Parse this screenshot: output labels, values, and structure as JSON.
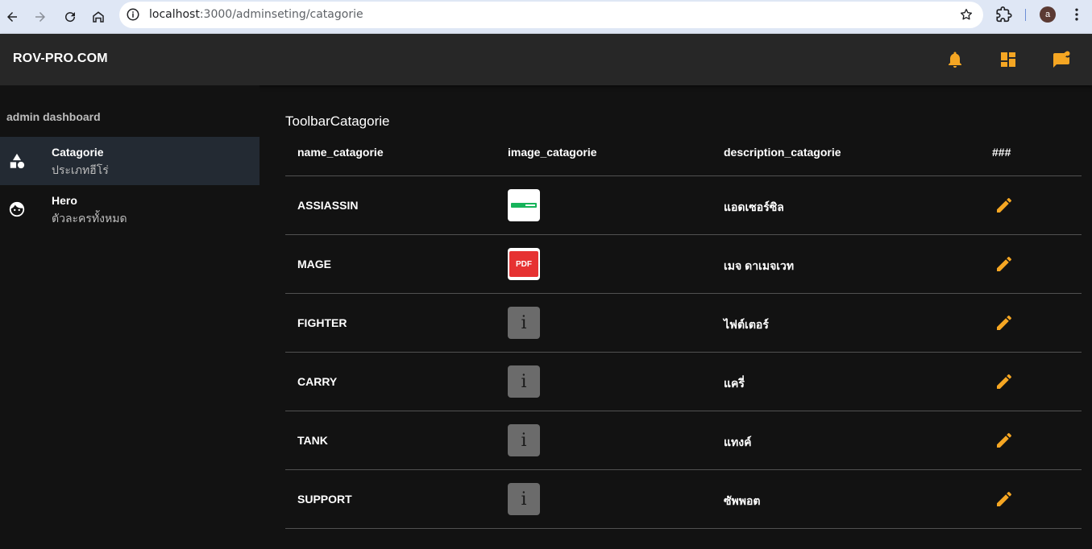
{
  "browser": {
    "url_host": "localhost",
    "url_path": ":3000/adminseting/catagorie",
    "profile_initial": "a"
  },
  "header": {
    "brand": "ROV-PRO.COM",
    "icons": [
      "bell-icon",
      "dashboard-icon",
      "chat-icon"
    ],
    "accent_color": "#f5a623"
  },
  "sidebar": {
    "title": "admin dashboard",
    "items": [
      {
        "label": "Catagorie",
        "sub": "ประเภทฮีโร่",
        "icon": "category-shapes-icon",
        "active": true
      },
      {
        "label": "Hero",
        "sub": "ตัวละครทั้งหมด",
        "icon": "face-icon",
        "active": false
      }
    ]
  },
  "main": {
    "title": "ToolbarCatagorie",
    "columns": [
      "name_catagorie",
      "image_catagorie",
      "description_catagorie",
      "###"
    ],
    "rows": [
      {
        "name": "ASSIASSIN",
        "image": "green-banner-thumb",
        "description": "แอดเซอร์ซิล"
      },
      {
        "name": "MAGE",
        "image": "pdf-thumb",
        "image_text": "PDF",
        "description": "เมจ ดาเมจเวท"
      },
      {
        "name": "FIGHTER",
        "image": "info-thumb",
        "image_text": "i",
        "description": "ไฟต์เตอร์"
      },
      {
        "name": "CARRY",
        "image": "info-thumb",
        "image_text": "i",
        "description": "แครี่"
      },
      {
        "name": "TANK",
        "image": "info-thumb",
        "image_text": "i",
        "description": "แทงค์"
      },
      {
        "name": "SUPPORT",
        "image": "info-thumb",
        "image_text": "i",
        "description": "ซัพพอต"
      }
    ]
  }
}
